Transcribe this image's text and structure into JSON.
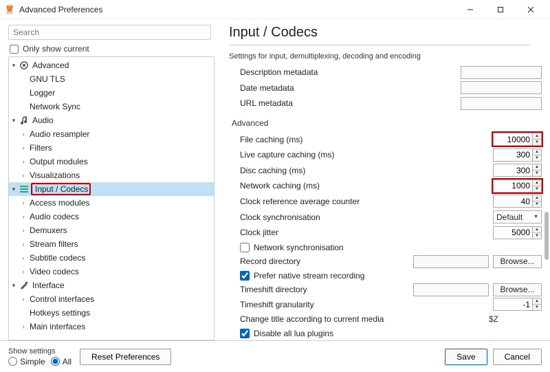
{
  "window": {
    "title": "Advanced Preferences"
  },
  "left": {
    "search_placeholder": "Search",
    "only_show_current": "Only show current",
    "tree": {
      "advanced": "Advanced",
      "gnu_tls": "GNU TLS",
      "logger": "Logger",
      "network_sync": "Network Sync",
      "audio": "Audio",
      "audio_resampler": "Audio resampler",
      "filters": "Filters",
      "output_modules": "Output modules",
      "visualizations": "Visualizations",
      "input_codecs": "Input / Codecs",
      "access_modules": "Access modules",
      "audio_codecs": "Audio codecs",
      "demuxers": "Demuxers",
      "stream_filters": "Stream filters",
      "subtitle_codecs": "Subtitle codecs",
      "video_codecs": "Video codecs",
      "interface": "Interface",
      "control_interfaces": "Control interfaces",
      "hotkeys_settings": "Hotkeys settings",
      "main_interfaces": "Main interfaces"
    }
  },
  "right": {
    "title": "Input / Codecs",
    "subtitle": "Settings for input, demultiplexing, decoding and encoding",
    "desc_metadata": "Description metadata",
    "date_metadata": "Date metadata",
    "url_metadata": "URL metadata",
    "advanced_label": "Advanced",
    "file_caching": "File caching (ms)",
    "file_caching_val": "10000",
    "live_capture_caching": "Live capture caching (ms)",
    "live_capture_val": "300",
    "disc_caching": "Disc caching (ms)",
    "disc_caching_val": "300",
    "network_caching": "Network caching (ms)",
    "network_caching_val": "1000",
    "clock_ref_avg": "Clock reference average counter",
    "clock_ref_avg_val": "40",
    "clock_sync": "Clock synchronisation",
    "clock_sync_val": "Default",
    "clock_jitter": "Clock jitter",
    "clock_jitter_val": "5000",
    "network_sync_chk": "Network synchronisation",
    "record_dir": "Record directory",
    "browse": "Browse...",
    "prefer_native": "Prefer native stream recording",
    "timeshift_dir": "Timeshift directory",
    "timeshift_gran": "Timeshift granularity",
    "timeshift_gran_val": "-1",
    "change_title": "Change title according to current media",
    "change_title_val": "$Z",
    "disable_lua": "Disable all lua plugins"
  },
  "footer": {
    "show_settings": "Show settings",
    "simple": "Simple",
    "all": "All",
    "reset": "Reset Preferences",
    "save": "Save",
    "cancel": "Cancel"
  }
}
